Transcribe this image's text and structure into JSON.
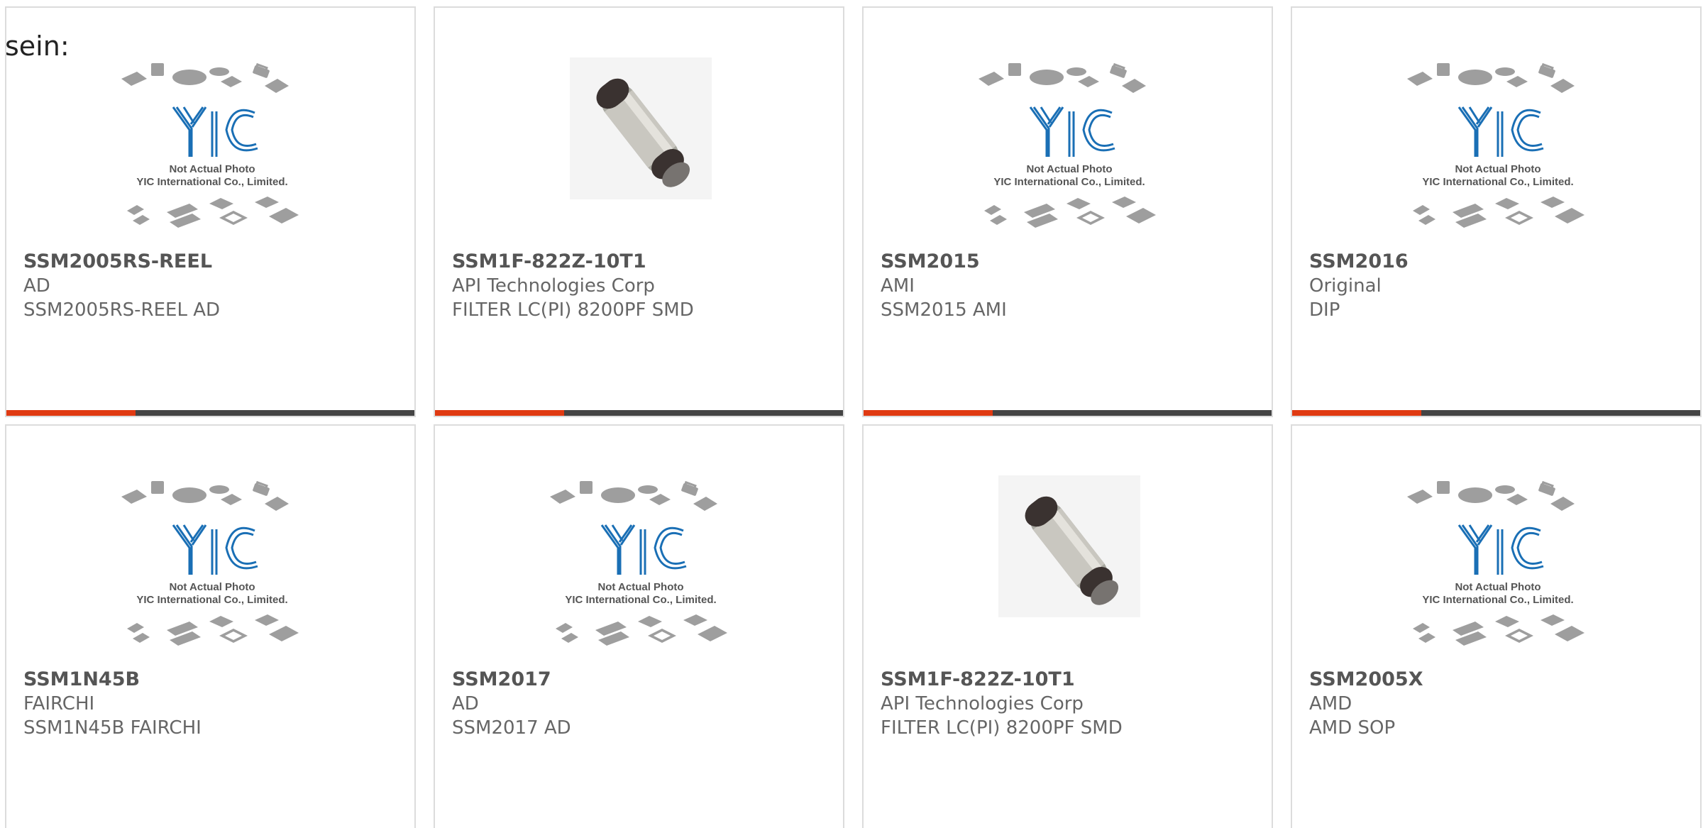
{
  "intro_text": "sein:",
  "colors": {
    "accent": "#e03a12",
    "bar_dark": "#444444",
    "logo_blue": "#1a6fb5"
  },
  "placeholder": {
    "line1": "Not Actual Photo",
    "line2": "YIC International Co., Limited."
  },
  "products": [
    {
      "part": "SSM2005RS-REEL",
      "maker": "AD",
      "desc": "SSM2005RS-REEL AD",
      "image": "placeholder"
    },
    {
      "part": "SSM1F-822Z-10T1",
      "maker": "API Technologies Corp",
      "desc": "FILTER LC(PI) 8200PF SMD",
      "image": "filter-photo"
    },
    {
      "part": "SSM2015",
      "maker": "AMI",
      "desc": "SSM2015 AMI",
      "image": "placeholder"
    },
    {
      "part": "SSM2016",
      "maker": "Original",
      "desc": "DIP",
      "image": "placeholder"
    },
    {
      "part": "SSM1N45B",
      "maker": "FAIRCHI",
      "desc": "SSM1N45B FAIRCHI",
      "image": "placeholder"
    },
    {
      "part": "SSM2017",
      "maker": "AD",
      "desc": "SSM2017 AD",
      "image": "placeholder"
    },
    {
      "part": "SSM1F-822Z-10T1",
      "maker": "API Technologies Corp",
      "desc": "FILTER LC(PI) 8200PF SMD",
      "image": "filter-photo"
    },
    {
      "part": "SSM2005X",
      "maker": "AMD",
      "desc": "AMD SOP",
      "image": "placeholder"
    }
  ]
}
